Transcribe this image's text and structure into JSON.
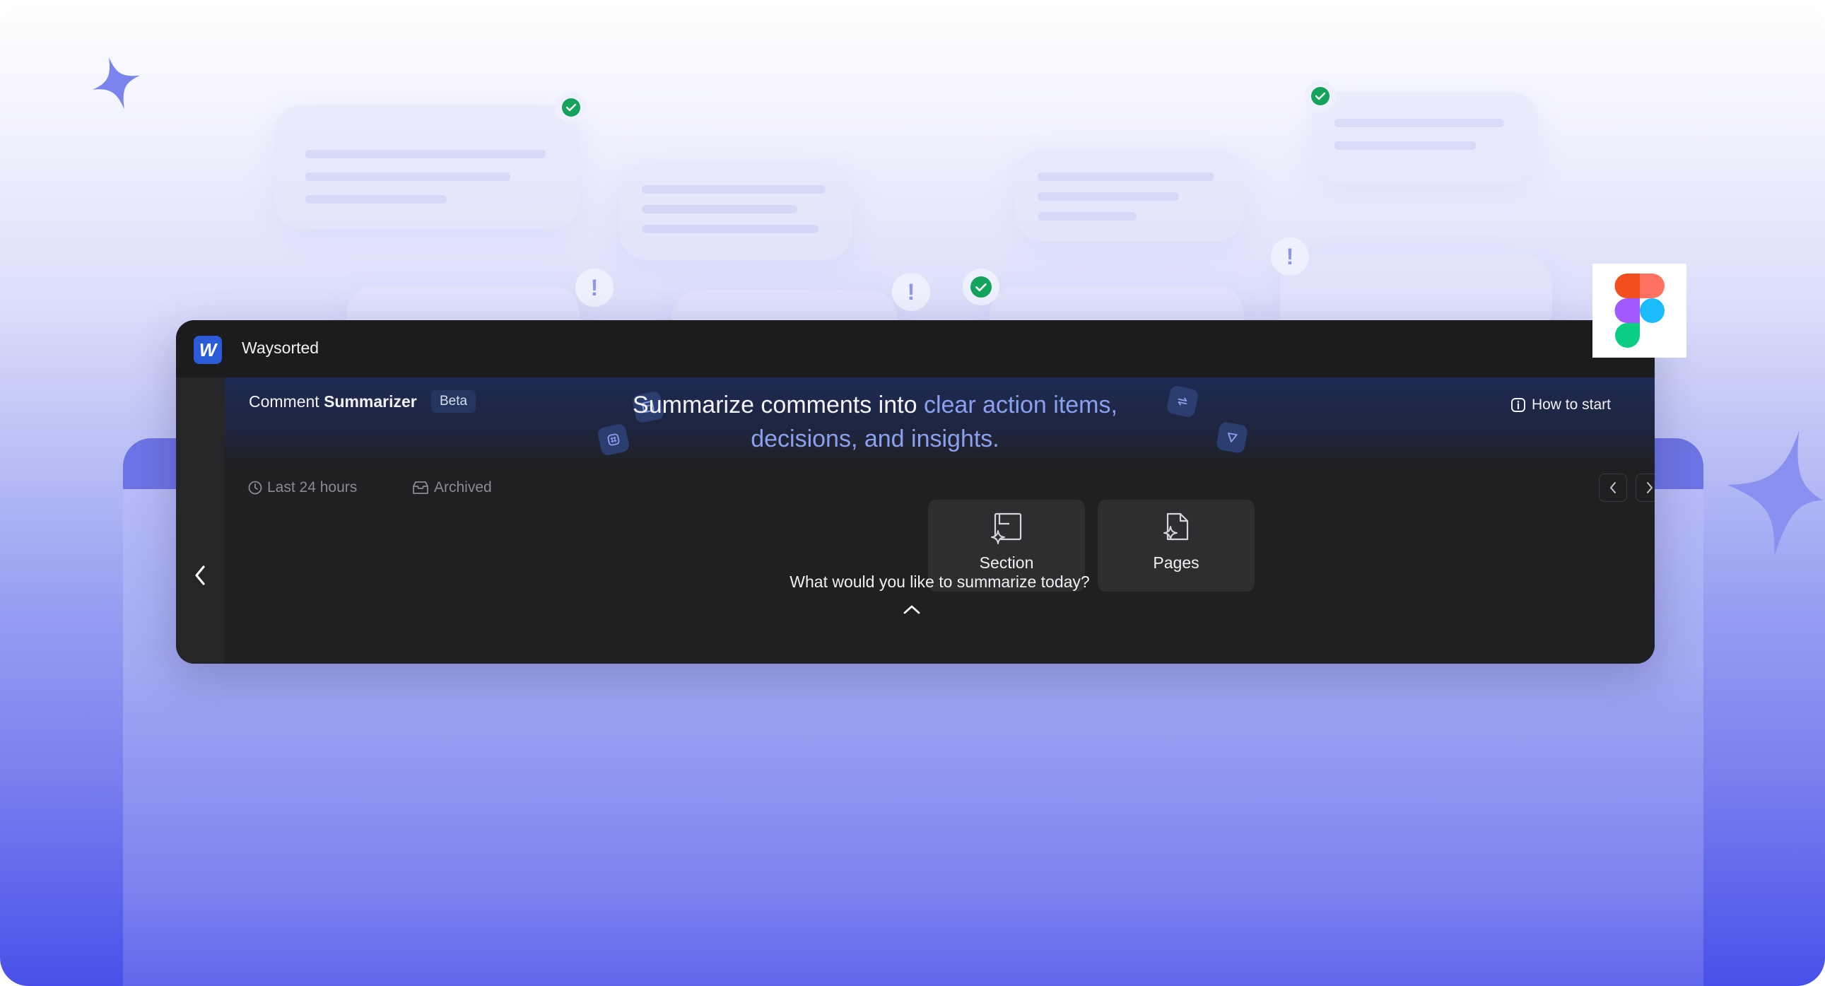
{
  "app": {
    "name": "Waysorted",
    "logo_letter": "W"
  },
  "plugin": {
    "title_prefix": "Comment ",
    "title_bold": "Summarizer",
    "badge": "Beta",
    "headline_plain": "Summarize comments into ",
    "headline_accent": "clear action items, decisions, and insights.",
    "help_link": "How to start"
  },
  "filters": [
    {
      "label": "Last 24 hours",
      "icon": "clock-icon"
    },
    {
      "label": "Archived",
      "icon": "archive-icon"
    }
  ],
  "options": [
    {
      "label": "Section",
      "icon": "section-sparkle-icon"
    },
    {
      "label": "Pages",
      "icon": "page-sparkle-icon"
    }
  ],
  "prompt": "What would you like to summarize today?",
  "colors": {
    "accent": "#8ca0f0",
    "window_bg": "#1f1f21",
    "card_bg": "#2e2e31",
    "success": "#13a35a",
    "brand_blue": "#2b5bd7"
  }
}
